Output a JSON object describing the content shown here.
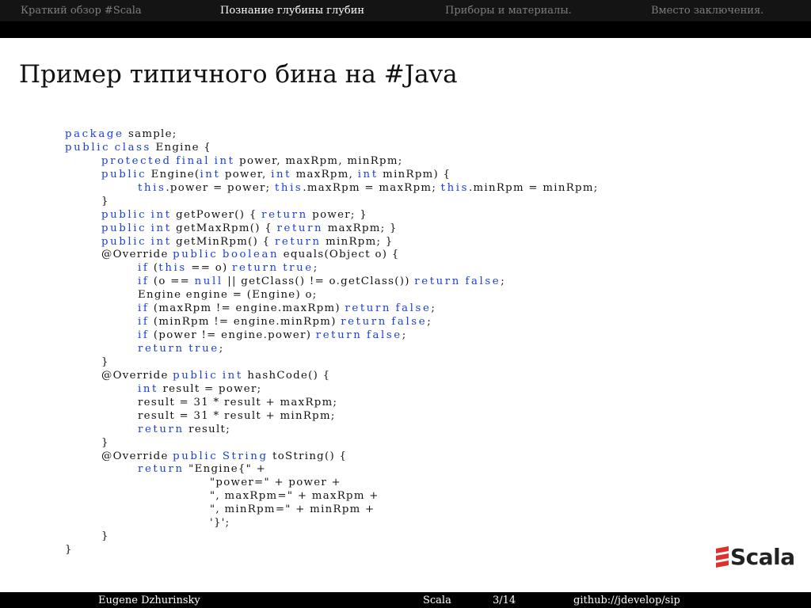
{
  "nav": {
    "items": [
      {
        "label": "Краткий обзор #Scala"
      },
      {
        "label": "Познание глубины глубин"
      },
      {
        "label": "Приборы и материалы."
      },
      {
        "label": "Вместо заключения."
      }
    ],
    "active_index": 1
  },
  "slide": {
    "title": "Пример типичного бина на #Java",
    "code_lines": [
      {
        "indent": 0,
        "parts": [
          {
            "t": "package",
            "k": 1
          },
          {
            "t": " sample;"
          }
        ]
      },
      {
        "indent": 0,
        "parts": [
          {
            "t": "public",
            "k": 1
          },
          {
            "t": " "
          },
          {
            "t": "class",
            "k": 1
          },
          {
            "t": " Engine {"
          }
        ]
      },
      {
        "indent": 1,
        "parts": [
          {
            "t": "protected",
            "k": 1
          },
          {
            "t": " "
          },
          {
            "t": "final",
            "k": 1
          },
          {
            "t": " "
          },
          {
            "t": "int",
            "k": 1
          },
          {
            "t": " power, maxRpm, minRpm;"
          }
        ]
      },
      {
        "indent": 1,
        "parts": [
          {
            "t": "public",
            "k": 1
          },
          {
            "t": " Engine("
          },
          {
            "t": "int",
            "k": 1
          },
          {
            "t": " power, "
          },
          {
            "t": "int",
            "k": 1
          },
          {
            "t": " maxRpm, "
          },
          {
            "t": "int",
            "k": 1
          },
          {
            "t": " minRpm) {"
          }
        ]
      },
      {
        "indent": 2,
        "parts": [
          {
            "t": "this",
            "k": 1
          },
          {
            "t": ".power = power; "
          },
          {
            "t": "this",
            "k": 1
          },
          {
            "t": ".maxRpm = maxRpm; "
          },
          {
            "t": "this",
            "k": 1
          },
          {
            "t": ".minRpm = minRpm;"
          }
        ]
      },
      {
        "indent": 1,
        "parts": [
          {
            "t": "}"
          }
        ]
      },
      {
        "indent": 1,
        "parts": [
          {
            "t": "public",
            "k": 1
          },
          {
            "t": " "
          },
          {
            "t": "int",
            "k": 1
          },
          {
            "t": " getPower() { "
          },
          {
            "t": "return",
            "k": 1
          },
          {
            "t": " power; }"
          }
        ]
      },
      {
        "indent": 1,
        "parts": [
          {
            "t": "public",
            "k": 1
          },
          {
            "t": " "
          },
          {
            "t": "int",
            "k": 1
          },
          {
            "t": " getMaxRpm() { "
          },
          {
            "t": "return",
            "k": 1
          },
          {
            "t": " maxRpm; }"
          }
        ]
      },
      {
        "indent": 1,
        "parts": [
          {
            "t": "public",
            "k": 1
          },
          {
            "t": " "
          },
          {
            "t": "int",
            "k": 1
          },
          {
            "t": " getMinRpm() { "
          },
          {
            "t": "return",
            "k": 1
          },
          {
            "t": " minRpm; }"
          }
        ]
      },
      {
        "indent": 1,
        "parts": [
          {
            "t": "@Override "
          },
          {
            "t": "public",
            "k": 1
          },
          {
            "t": " "
          },
          {
            "t": "boolean",
            "k": 1
          },
          {
            "t": " equals(Object o) {"
          }
        ]
      },
      {
        "indent": 2,
        "parts": [
          {
            "t": "if",
            "k": 1
          },
          {
            "t": " ("
          },
          {
            "t": "this",
            "k": 1
          },
          {
            "t": " == o) "
          },
          {
            "t": "return",
            "k": 1
          },
          {
            "t": " "
          },
          {
            "t": "true",
            "k": 1
          },
          {
            "t": ";"
          }
        ]
      },
      {
        "indent": 2,
        "parts": [
          {
            "t": "if",
            "k": 1
          },
          {
            "t": " (o == "
          },
          {
            "t": "null",
            "k": 1
          },
          {
            "t": " || getClass() != o.getClass()) "
          },
          {
            "t": "return",
            "k": 1
          },
          {
            "t": " "
          },
          {
            "t": "false",
            "k": 1
          },
          {
            "t": ";"
          }
        ]
      },
      {
        "indent": 2,
        "parts": [
          {
            "t": "Engine engine = (Engine) o;"
          }
        ]
      },
      {
        "indent": 2,
        "parts": [
          {
            "t": "if",
            "k": 1
          },
          {
            "t": " (maxRpm != engine.maxRpm) "
          },
          {
            "t": "return",
            "k": 1
          },
          {
            "t": " "
          },
          {
            "t": "false",
            "k": 1
          },
          {
            "t": ";"
          }
        ]
      },
      {
        "indent": 2,
        "parts": [
          {
            "t": "if",
            "k": 1
          },
          {
            "t": " (minRpm != engine.minRpm) "
          },
          {
            "t": "return",
            "k": 1
          },
          {
            "t": " "
          },
          {
            "t": "false",
            "k": 1
          },
          {
            "t": ";"
          }
        ]
      },
      {
        "indent": 2,
        "parts": [
          {
            "t": "if",
            "k": 1
          },
          {
            "t": " (power != engine.power) "
          },
          {
            "t": "return",
            "k": 1
          },
          {
            "t": " "
          },
          {
            "t": "false",
            "k": 1
          },
          {
            "t": ";"
          }
        ]
      },
      {
        "indent": 2,
        "parts": [
          {
            "t": "return",
            "k": 1
          },
          {
            "t": " "
          },
          {
            "t": "true",
            "k": 1
          },
          {
            "t": ";"
          }
        ]
      },
      {
        "indent": 1,
        "parts": [
          {
            "t": "}"
          }
        ]
      },
      {
        "indent": 1,
        "parts": [
          {
            "t": "@Override "
          },
          {
            "t": "public",
            "k": 1
          },
          {
            "t": " "
          },
          {
            "t": "int",
            "k": 1
          },
          {
            "t": " hashCode() {"
          }
        ]
      },
      {
        "indent": 2,
        "parts": [
          {
            "t": "int",
            "k": 1
          },
          {
            "t": " result = power;"
          }
        ]
      },
      {
        "indent": 2,
        "parts": [
          {
            "t": "result = 31 * result + maxRpm;"
          }
        ]
      },
      {
        "indent": 2,
        "parts": [
          {
            "t": "result = 31 * result + minRpm;"
          }
        ]
      },
      {
        "indent": 2,
        "parts": [
          {
            "t": "return",
            "k": 1
          },
          {
            "t": " result;"
          }
        ]
      },
      {
        "indent": 1,
        "parts": [
          {
            "t": "}"
          }
        ]
      },
      {
        "indent": 1,
        "parts": [
          {
            "t": "@Override "
          },
          {
            "t": "public",
            "k": 1
          },
          {
            "t": " "
          },
          {
            "t": "String",
            "k": 1
          },
          {
            "t": " toString() {"
          }
        ]
      },
      {
        "indent": 2,
        "parts": [
          {
            "t": "return",
            "k": 1
          },
          {
            "t": " \"Engine{\" +"
          }
        ]
      },
      {
        "indent": 3,
        "parts": [
          {
            "t": "\"power=\" + power +"
          }
        ]
      },
      {
        "indent": 3,
        "parts": [
          {
            "t": "\", maxRpm=\" + maxRpm +"
          }
        ]
      },
      {
        "indent": 3,
        "parts": [
          {
            "t": "\", minRpm=\" + minRpm +"
          }
        ]
      },
      {
        "indent": 3,
        "parts": [
          {
            "t": "'}';"
          }
        ]
      },
      {
        "indent": 1,
        "parts": [
          {
            "t": "}"
          }
        ]
      },
      {
        "indent": 0,
        "parts": [
          {
            "t": "}"
          }
        ]
      }
    ]
  },
  "logo": {
    "text": "Scala",
    "icon": "scala-stairs-icon",
    "color": "#dc322f"
  },
  "footer": {
    "author": "Eugene Dzhurinsky",
    "topic": "Scala",
    "page": "3/14",
    "repo": "github://jdevelop/sip"
  },
  "colors": {
    "keyword": "#1a3fd6",
    "bar": "#000000",
    "nav_inactive": "#7e7e7e"
  }
}
